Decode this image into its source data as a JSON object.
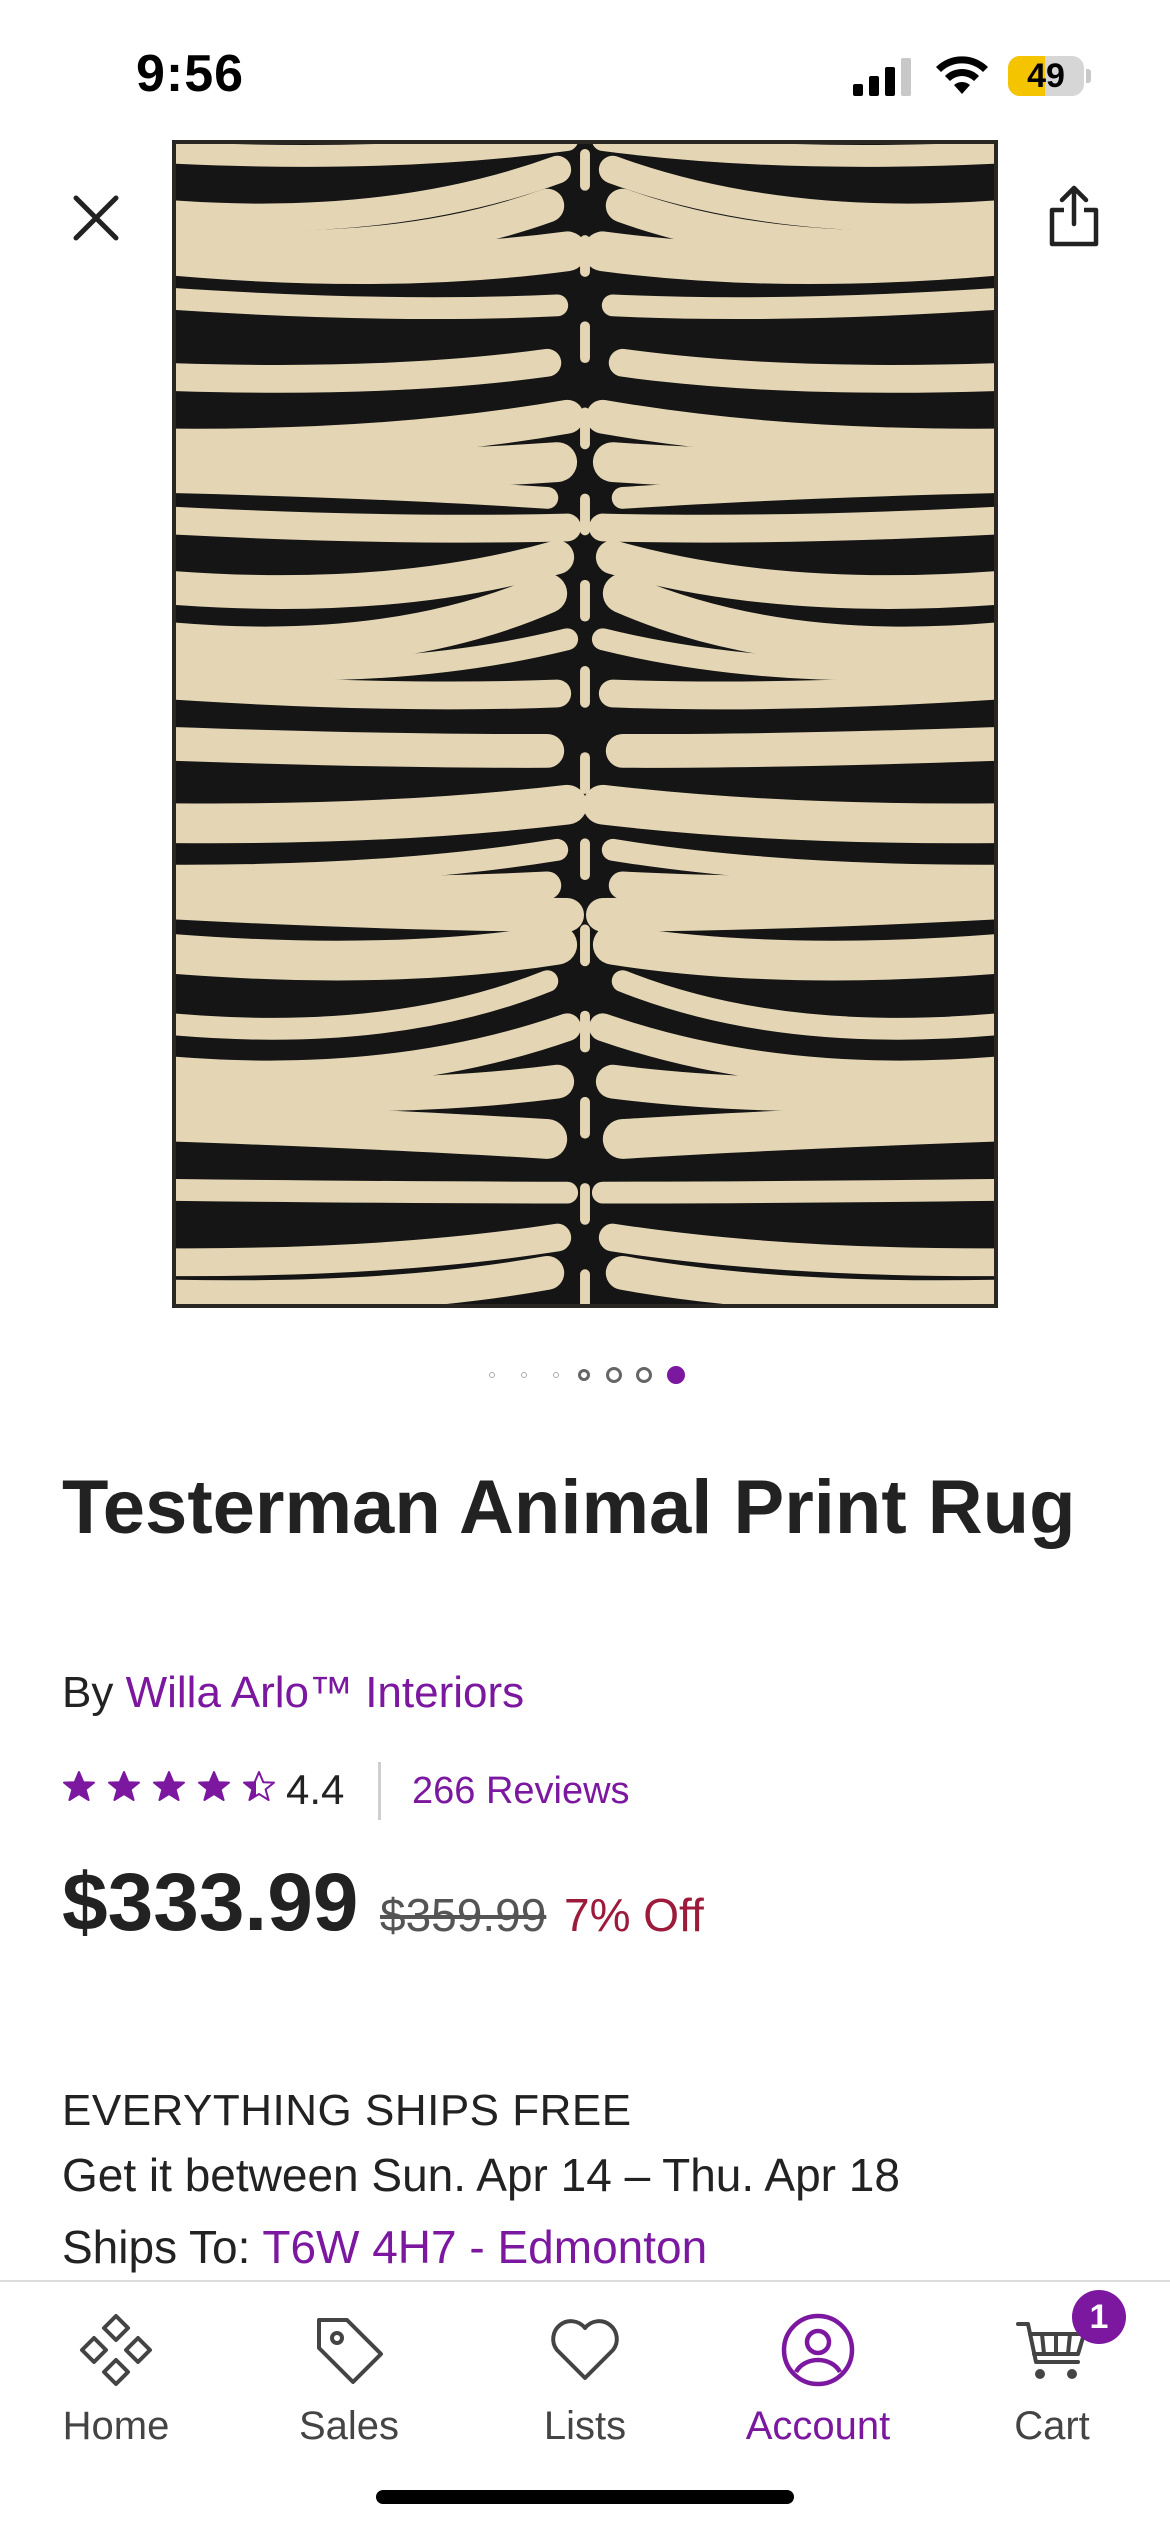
{
  "status_bar": {
    "time": "9:56",
    "battery_level": "49",
    "battery_fraction": 0.49,
    "battery_color": "#f5c400"
  },
  "image_carousel": {
    "total_slides": 7,
    "active_index": 6,
    "close_icon": "close-icon",
    "share_icon": "share-icon"
  },
  "product": {
    "title": "Testerman Animal Print Rug",
    "by_label": "By",
    "brand": "Willa Arlo™ Interiors",
    "rating_stars": 4.4,
    "rating_text": "4.4",
    "reviews_label": "266 Reviews",
    "price": "$333.99",
    "was_price": "$359.99",
    "discount": "7% Off"
  },
  "shipping": {
    "free_label": "EVERYTHING SHIPS FREE",
    "window": "Get it between Sun. Apr 14 – Thu. Apr 18",
    "ships_to_label": "Ships To:",
    "location": "T6W 4H7 - Edmonton"
  },
  "tab_bar": {
    "items": [
      {
        "label": "Home",
        "icon": "home-icon"
      },
      {
        "label": "Sales",
        "icon": "tag-icon"
      },
      {
        "label": "Lists",
        "icon": "heart-icon"
      },
      {
        "label": "Account",
        "icon": "account-icon"
      },
      {
        "label": "Cart",
        "icon": "cart-icon"
      }
    ],
    "active": "Account",
    "cart_badge": "1"
  },
  "colors": {
    "brand_purple": "#7b189f",
    "discount_red": "#9c1b3a",
    "rug_dark": "#151515",
    "rug_light": "#e4d6b4"
  }
}
